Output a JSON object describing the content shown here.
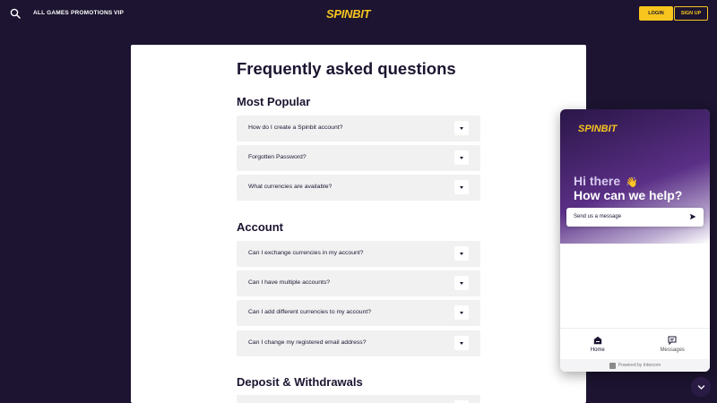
{
  "nav": {
    "links": [
      "ALL GAMES",
      "PROMOTIONS",
      "VIP"
    ],
    "logo": "SPINBIT",
    "login_label": "LOGIN",
    "signup_label": "SIGN UP"
  },
  "faq": {
    "title": "Frequently asked questions",
    "sections": [
      {
        "heading": "Most Popular",
        "questions": [
          "How do I create a Spinbit account?",
          "Forgotten Password?",
          "What currencies are available?"
        ]
      },
      {
        "heading": "Account",
        "questions": [
          "Can I exchange currencies in my account?",
          "Can I have multiple accounts?",
          "Can I add different currencies to my account?",
          "Can I change my registered email address?"
        ]
      },
      {
        "heading": "Deposit & Withdrawals",
        "questions": [
          ""
        ]
      }
    ]
  },
  "chat": {
    "logo": "SPINBIT",
    "greeting": "Hi there",
    "greeting_emoji": "👋",
    "subtitle": "How can we help?",
    "input_placeholder": "Send us a message",
    "tabs": [
      {
        "label": "Home",
        "icon": "home-icon"
      },
      {
        "label": "Messages",
        "icon": "messages-icon"
      }
    ],
    "footer": "Powered by Intercom"
  },
  "colors": {
    "background": "#1c1430",
    "brand_yellow": "#f7c51e",
    "panel": "#ffffff",
    "question_bg": "#f1f1f1"
  }
}
